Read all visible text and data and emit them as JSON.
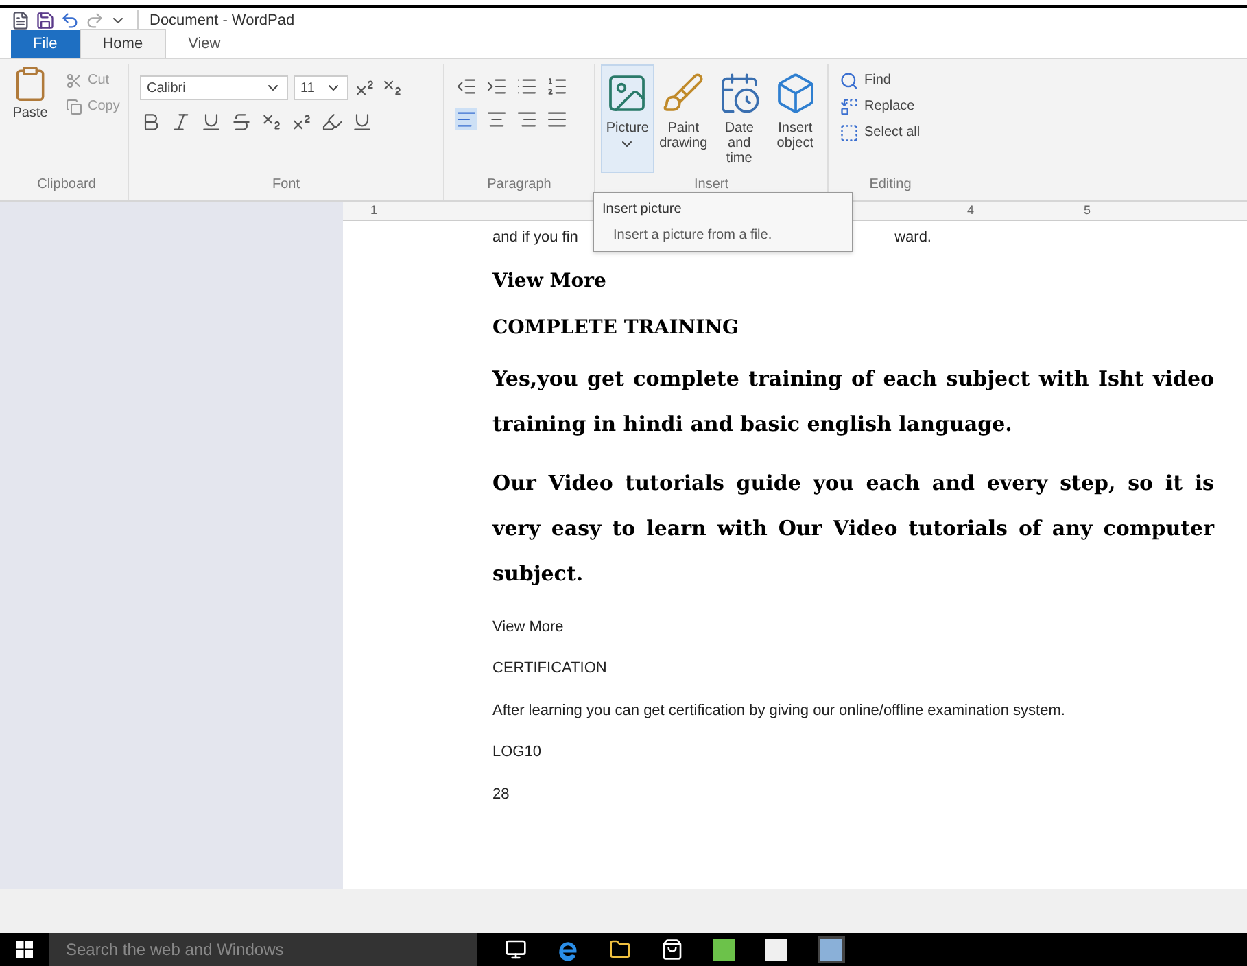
{
  "window": {
    "title": "Document - WordPad"
  },
  "tabs": [
    {
      "label": "File",
      "kind": "menu",
      "selected": false
    },
    {
      "label": "Home",
      "kind": "tab",
      "selected": true
    },
    {
      "label": "View",
      "kind": "tab",
      "selected": false
    }
  ],
  "ribbon": {
    "clipboard": {
      "label": "Clipboard",
      "paste": "Paste",
      "cut": "Cut",
      "copy": "Copy"
    },
    "font": {
      "label": "Font",
      "font_name": "Calibri",
      "font_size": "11"
    },
    "paragraph": {
      "label": "Paragraph"
    },
    "insert": {
      "label": "Insert",
      "buttons": [
        {
          "label": "Picture",
          "kind": "picture",
          "hovered": true
        },
        {
          "label": "Paint drawing",
          "kind": "paint",
          "hovered": false
        },
        {
          "label": "Date and time",
          "kind": "calendar",
          "hovered": false
        },
        {
          "label": "Insert object",
          "kind": "object",
          "hovered": false
        }
      ]
    },
    "editing": {
      "label": "Editing",
      "buttons": [
        {
          "label": "Find",
          "kind": "find"
        },
        {
          "label": "Replace",
          "kind": "replace"
        },
        {
          "label": "Select all",
          "kind": "select"
        }
      ]
    }
  },
  "ruler": {
    "numbers": [
      "1",
      "4",
      "5"
    ]
  },
  "tooltip": {
    "title": "Insert picture",
    "text": "Insert a picture from a file."
  },
  "document": {
    "first_line": {
      "left": "and if you fin",
      "right": "ward."
    },
    "paragraphs": [
      {
        "kind": "heading",
        "text": "View More"
      },
      {
        "kind": "heading",
        "text": "COMPLETE TRAINING"
      },
      {
        "kind": "body",
        "text": "Yes,you get complete training of each subject with Isht video training in hindi and basic english language."
      },
      {
        "kind": "body",
        "text": "Our Video tutorials guide you each and every step, so it is very easy to learn with Our Video tutorials of any computer subject."
      },
      {
        "kind": "plain",
        "text": "View More"
      },
      {
        "kind": "plain",
        "text": "CERTIFICATION"
      },
      {
        "kind": "plain",
        "text": "After learning you can get certification by giving our online/offline examination system."
      },
      {
        "kind": "plain",
        "text": "LOG10"
      },
      {
        "kind": "plain",
        "text": "28"
      }
    ]
  },
  "taskbar": {
    "search": {
      "placeholder": "Search the web and Windows"
    }
  }
}
